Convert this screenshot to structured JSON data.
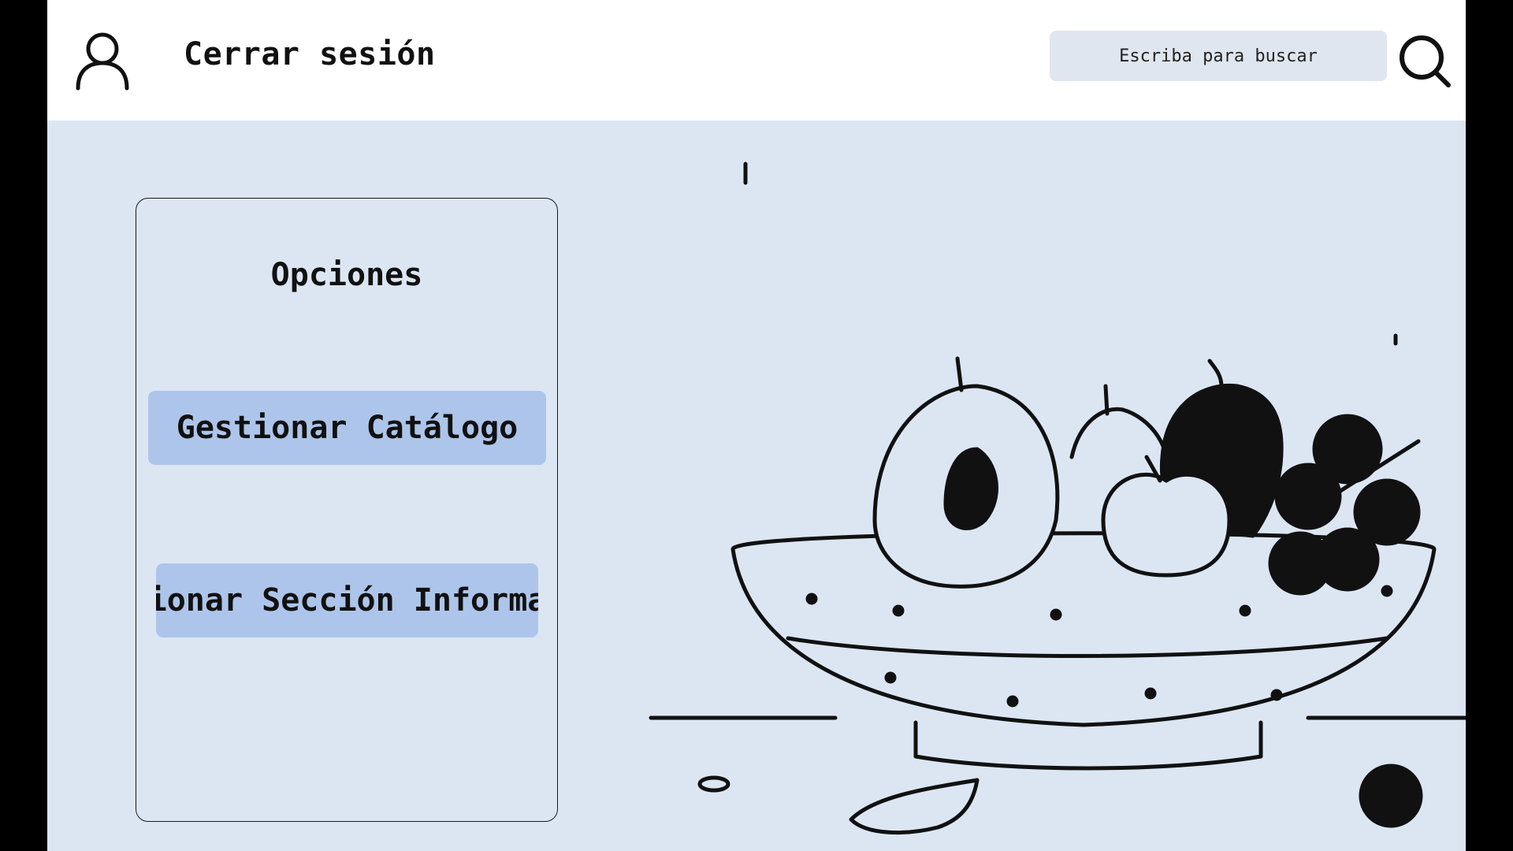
{
  "header": {
    "user_icon": "user-icon",
    "logout_label": "Cerrar sesión",
    "search": {
      "placeholder": "Escriba para buscar",
      "value": ""
    },
    "search_icon": "search-icon"
  },
  "options_panel": {
    "title": "Opciones",
    "buttons": [
      {
        "label": "Gestionar Catálogo"
      },
      {
        "label": "Gestionar Sección Información"
      }
    ]
  },
  "illustration": {
    "subject": "fruit-bowl",
    "icon": "fruit-bowl-illustration"
  },
  "colors": {
    "background": "#dce6f3",
    "header": "#ffffff",
    "button": "#adc5ea",
    "search_field": "#e0e6ef",
    "frame": "#000000"
  }
}
